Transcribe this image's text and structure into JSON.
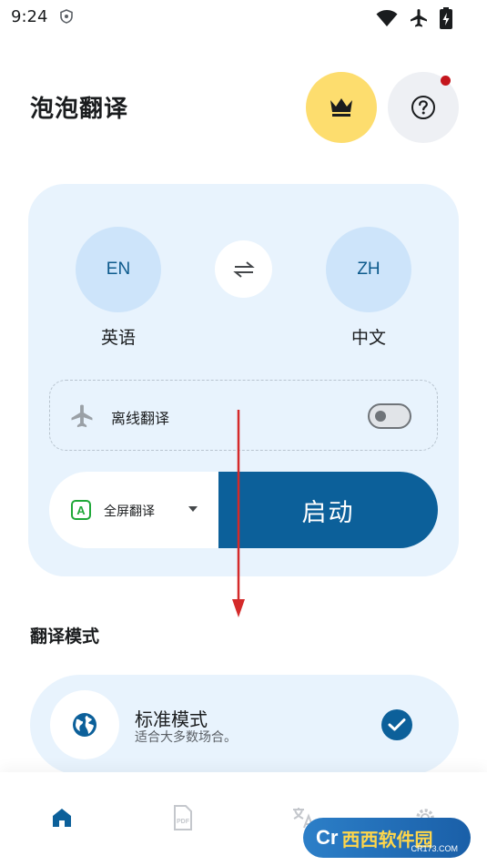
{
  "status_bar": {
    "time": "9:24",
    "icons": [
      "shield-icon",
      "wifi-icon",
      "airplane-icon",
      "battery-charging-icon"
    ]
  },
  "header": {
    "title": "泡泡翻译",
    "premium_icon": "crown-icon",
    "help_icon": "question-icon",
    "help_badge_color": "#c4151c",
    "premium_color": "#fddd6e"
  },
  "languages": {
    "source_code": "EN",
    "source_name": "英语",
    "target_code": "ZH",
    "target_name": "中文",
    "swap_icon": "swap-arrows-icon"
  },
  "offline": {
    "label": "离线翻译",
    "icon": "airplane-icon",
    "enabled": false
  },
  "mode_selector": {
    "icon_letter": "A",
    "selected": "全屏翻译",
    "accent": "#1fa838"
  },
  "start_button": {
    "label": "启动",
    "color": "#0c609a"
  },
  "section": {
    "title": "翻译模式"
  },
  "translation_modes": [
    {
      "title": "标准模式",
      "description": "适合大多数场合。",
      "icon": "globe-icon",
      "selected": true
    }
  ],
  "bottom_nav": {
    "items": [
      {
        "icon": "home-icon",
        "active": true
      },
      {
        "icon": "pdf-icon",
        "active": false
      },
      {
        "icon": "translate-icon",
        "active": false
      },
      {
        "icon": "settings-icon",
        "active": false
      }
    ],
    "active_color": "#0c609a"
  },
  "watermark": {
    "logo_text": "Cr",
    "text": "西西软件园",
    "sub": "CR173.COM"
  }
}
